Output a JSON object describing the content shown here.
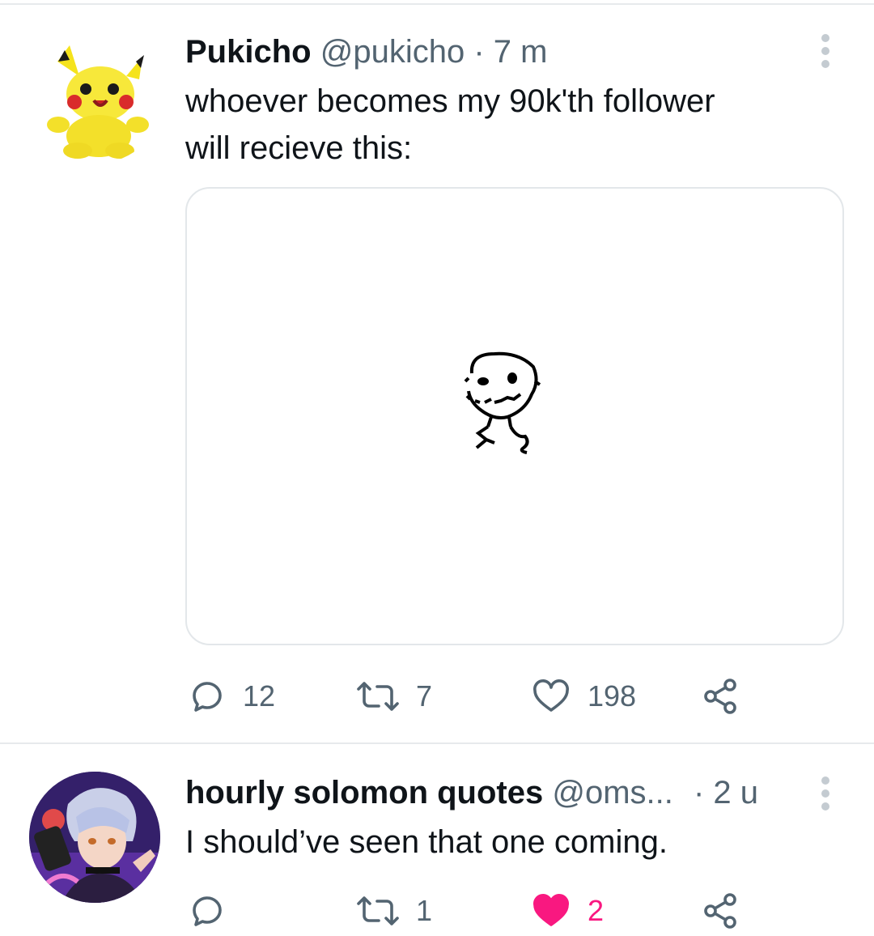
{
  "tweets": [
    {
      "name": "Pukicho",
      "handle": "@pukicho",
      "time": "· 7 m",
      "text_line1": "whoever becomes my 90k'th follower",
      "text_line2": "will recieve this:",
      "avatar_icon": "pikachu-plush-avatar",
      "media_icon": "stick-figure-drawing",
      "stats": {
        "replies": "12",
        "retweets": "7",
        "likes": "198"
      }
    },
    {
      "name": "hourly solomon quotes",
      "handle": "@oms...",
      "time": "· 2 u",
      "text": "I should’ve seen that one coming.",
      "avatar_icon": "anime-character-avatar",
      "stats": {
        "replies": "",
        "retweets": "1",
        "likes": "2"
      },
      "liked": true
    }
  ],
  "colors": {
    "muted": "#536471",
    "like_active": "#f91880",
    "divider": "#e7eaec"
  }
}
